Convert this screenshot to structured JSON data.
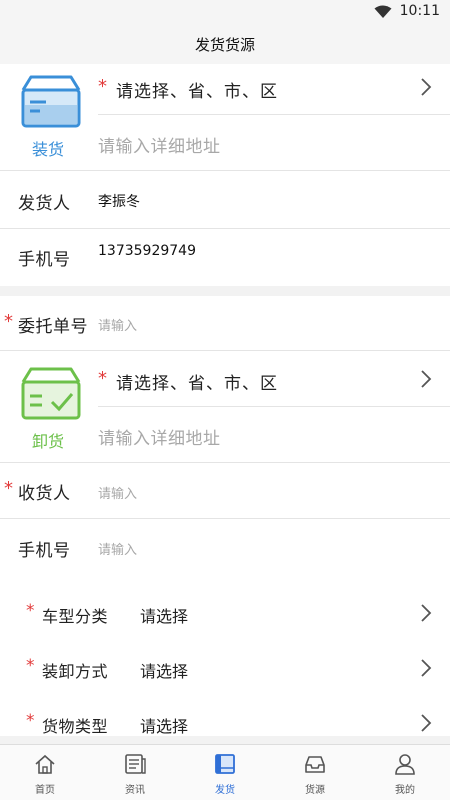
{
  "status_bar": {
    "time": "10:11"
  },
  "header": {
    "title": "发货货源"
  },
  "loading": {
    "icon_label": "装货",
    "region_star": "*",
    "region_placeholder": "请选择、省、市、区",
    "address_placeholder": "请输入详细地址",
    "accent": "#3a8fd8"
  },
  "shipper": {
    "label": "发货人",
    "value": "李振冬"
  },
  "shipper_phone": {
    "label": "手机号",
    "value": "13735929749"
  },
  "order_no": {
    "star": "*",
    "label": "委托单号",
    "placeholder": "请输入"
  },
  "unloading": {
    "icon_label": "卸货",
    "region_star": "*",
    "region_placeholder": "请选择、省、市、区",
    "address_placeholder": "请输入详细地址",
    "accent": "#6cc04a"
  },
  "receiver": {
    "star": "*",
    "label": "收货人",
    "placeholder": "请输入"
  },
  "receiver_phone": {
    "label": "手机号",
    "placeholder": "请输入"
  },
  "selects": [
    {
      "star": "*",
      "label": "车型分类",
      "value": "请选择"
    },
    {
      "star": "*",
      "label": "装卸方式",
      "value": "请选择"
    },
    {
      "star": "*",
      "label": "货物类型",
      "value": "请选择"
    }
  ],
  "tabs": [
    {
      "label": "首页",
      "icon": "home-icon"
    },
    {
      "label": "资讯",
      "icon": "news-icon"
    },
    {
      "label": "发货",
      "icon": "ship-icon",
      "active": true
    },
    {
      "label": "货源",
      "icon": "inbox-icon"
    },
    {
      "label": "我的",
      "icon": "person-icon"
    }
  ],
  "colors": {
    "active_tab": "#2f6fd6",
    "required_star": "#e23b3b",
    "placeholder": "#a8a8a8"
  }
}
